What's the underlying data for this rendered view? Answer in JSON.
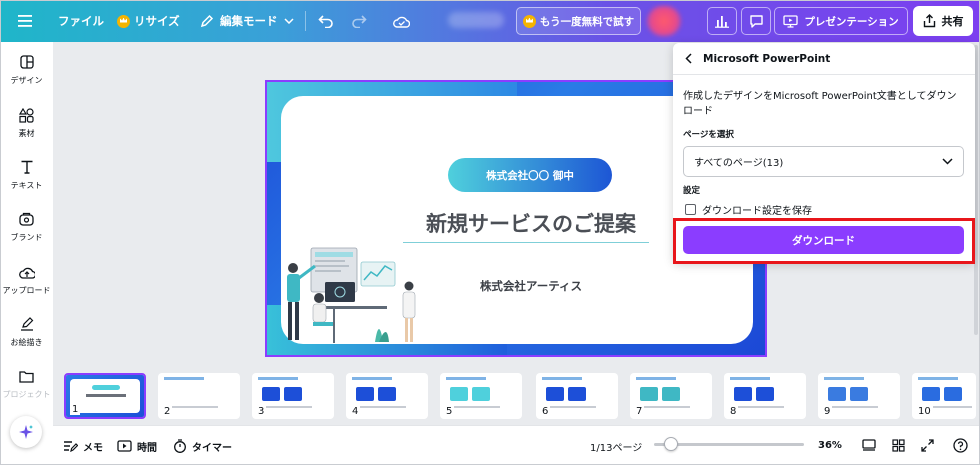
{
  "header": {
    "menu_icon": "hamburger-icon",
    "file_label": "ファイル",
    "resize_label": "リサイズ",
    "edit_mode_label": "編集モード",
    "trial_label": "もう一度無料で試す",
    "present_label": "プレゼンテーション",
    "share_label": "共有",
    "brand_colors": [
      "#1fb6c9",
      "#6a52e6",
      "#7c3ff0"
    ]
  },
  "sidebar": {
    "items": [
      {
        "label": "デザイン",
        "icon": "design-icon"
      },
      {
        "label": "素材",
        "icon": "elements-icon"
      },
      {
        "label": "テキスト",
        "icon": "text-icon"
      },
      {
        "label": "ブランド",
        "icon": "brand-icon"
      },
      {
        "label": "アップロード",
        "icon": "upload-icon"
      },
      {
        "label": "お絵描き",
        "icon": "draw-icon"
      },
      {
        "label": "プロジェクト",
        "icon": "folder-icon"
      }
    ]
  },
  "slide": {
    "pill_text": "株式会社〇〇 御中",
    "title": "新規サービスのご提案",
    "company": "株式会社アーティス"
  },
  "download_panel": {
    "title": "Microsoft PowerPoint",
    "description": "作成したデザインをMicrosoft PowerPoint文書としてダウンロード",
    "page_select_label": "ページを選択",
    "page_select_value": "すべてのページ(13)",
    "settings_label": "設定",
    "save_settings_label": "ダウンロード設定を保存",
    "save_settings_checked": false,
    "download_button": "ダウンロード",
    "accent_color": "#8b3dff",
    "highlight_color": "#e8161b"
  },
  "thumbnails": [
    {
      "num": "1"
    },
    {
      "num": "2"
    },
    {
      "num": "3"
    },
    {
      "num": "4"
    },
    {
      "num": "5"
    },
    {
      "num": "6"
    },
    {
      "num": "7"
    },
    {
      "num": "8"
    },
    {
      "num": "9"
    },
    {
      "num": "10"
    }
  ],
  "footer": {
    "memo_label": "メモ",
    "time_label": "時間",
    "timer_label": "タイマー",
    "page_indicator": "1/13ページ",
    "zoom_label": "36%",
    "zoom_value": 36
  }
}
